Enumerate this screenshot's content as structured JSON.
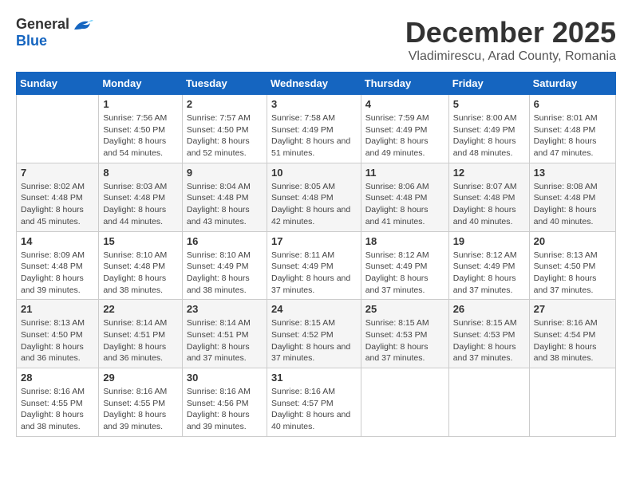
{
  "logo": {
    "general": "General",
    "blue": "Blue"
  },
  "title": "December 2025",
  "location": "Vladimirescu, Arad County, Romania",
  "weekdays": [
    "Sunday",
    "Monday",
    "Tuesday",
    "Wednesday",
    "Thursday",
    "Friday",
    "Saturday"
  ],
  "weeks": [
    [
      {
        "day": "",
        "sunrise": "",
        "sunset": "",
        "daylight": ""
      },
      {
        "day": "1",
        "sunrise": "Sunrise: 7:56 AM",
        "sunset": "Sunset: 4:50 PM",
        "daylight": "Daylight: 8 hours and 54 minutes."
      },
      {
        "day": "2",
        "sunrise": "Sunrise: 7:57 AM",
        "sunset": "Sunset: 4:50 PM",
        "daylight": "Daylight: 8 hours and 52 minutes."
      },
      {
        "day": "3",
        "sunrise": "Sunrise: 7:58 AM",
        "sunset": "Sunset: 4:49 PM",
        "daylight": "Daylight: 8 hours and 51 minutes."
      },
      {
        "day": "4",
        "sunrise": "Sunrise: 7:59 AM",
        "sunset": "Sunset: 4:49 PM",
        "daylight": "Daylight: 8 hours and 49 minutes."
      },
      {
        "day": "5",
        "sunrise": "Sunrise: 8:00 AM",
        "sunset": "Sunset: 4:49 PM",
        "daylight": "Daylight: 8 hours and 48 minutes."
      },
      {
        "day": "6",
        "sunrise": "Sunrise: 8:01 AM",
        "sunset": "Sunset: 4:48 PM",
        "daylight": "Daylight: 8 hours and 47 minutes."
      }
    ],
    [
      {
        "day": "7",
        "sunrise": "Sunrise: 8:02 AM",
        "sunset": "Sunset: 4:48 PM",
        "daylight": "Daylight: 8 hours and 45 minutes."
      },
      {
        "day": "8",
        "sunrise": "Sunrise: 8:03 AM",
        "sunset": "Sunset: 4:48 PM",
        "daylight": "Daylight: 8 hours and 44 minutes."
      },
      {
        "day": "9",
        "sunrise": "Sunrise: 8:04 AM",
        "sunset": "Sunset: 4:48 PM",
        "daylight": "Daylight: 8 hours and 43 minutes."
      },
      {
        "day": "10",
        "sunrise": "Sunrise: 8:05 AM",
        "sunset": "Sunset: 4:48 PM",
        "daylight": "Daylight: 8 hours and 42 minutes."
      },
      {
        "day": "11",
        "sunrise": "Sunrise: 8:06 AM",
        "sunset": "Sunset: 4:48 PM",
        "daylight": "Daylight: 8 hours and 41 minutes."
      },
      {
        "day": "12",
        "sunrise": "Sunrise: 8:07 AM",
        "sunset": "Sunset: 4:48 PM",
        "daylight": "Daylight: 8 hours and 40 minutes."
      },
      {
        "day": "13",
        "sunrise": "Sunrise: 8:08 AM",
        "sunset": "Sunset: 4:48 PM",
        "daylight": "Daylight: 8 hours and 40 minutes."
      }
    ],
    [
      {
        "day": "14",
        "sunrise": "Sunrise: 8:09 AM",
        "sunset": "Sunset: 4:48 PM",
        "daylight": "Daylight: 8 hours and 39 minutes."
      },
      {
        "day": "15",
        "sunrise": "Sunrise: 8:10 AM",
        "sunset": "Sunset: 4:48 PM",
        "daylight": "Daylight: 8 hours and 38 minutes."
      },
      {
        "day": "16",
        "sunrise": "Sunrise: 8:10 AM",
        "sunset": "Sunset: 4:49 PM",
        "daylight": "Daylight: 8 hours and 38 minutes."
      },
      {
        "day": "17",
        "sunrise": "Sunrise: 8:11 AM",
        "sunset": "Sunset: 4:49 PM",
        "daylight": "Daylight: 8 hours and 37 minutes."
      },
      {
        "day": "18",
        "sunrise": "Sunrise: 8:12 AM",
        "sunset": "Sunset: 4:49 PM",
        "daylight": "Daylight: 8 hours and 37 minutes."
      },
      {
        "day": "19",
        "sunrise": "Sunrise: 8:12 AM",
        "sunset": "Sunset: 4:49 PM",
        "daylight": "Daylight: 8 hours and 37 minutes."
      },
      {
        "day": "20",
        "sunrise": "Sunrise: 8:13 AM",
        "sunset": "Sunset: 4:50 PM",
        "daylight": "Daylight: 8 hours and 37 minutes."
      }
    ],
    [
      {
        "day": "21",
        "sunrise": "Sunrise: 8:13 AM",
        "sunset": "Sunset: 4:50 PM",
        "daylight": "Daylight: 8 hours and 36 minutes."
      },
      {
        "day": "22",
        "sunrise": "Sunrise: 8:14 AM",
        "sunset": "Sunset: 4:51 PM",
        "daylight": "Daylight: 8 hours and 36 minutes."
      },
      {
        "day": "23",
        "sunrise": "Sunrise: 8:14 AM",
        "sunset": "Sunset: 4:51 PM",
        "daylight": "Daylight: 8 hours and 37 minutes."
      },
      {
        "day": "24",
        "sunrise": "Sunrise: 8:15 AM",
        "sunset": "Sunset: 4:52 PM",
        "daylight": "Daylight: 8 hours and 37 minutes."
      },
      {
        "day": "25",
        "sunrise": "Sunrise: 8:15 AM",
        "sunset": "Sunset: 4:53 PM",
        "daylight": "Daylight: 8 hours and 37 minutes."
      },
      {
        "day": "26",
        "sunrise": "Sunrise: 8:15 AM",
        "sunset": "Sunset: 4:53 PM",
        "daylight": "Daylight: 8 hours and 37 minutes."
      },
      {
        "day": "27",
        "sunrise": "Sunrise: 8:16 AM",
        "sunset": "Sunset: 4:54 PM",
        "daylight": "Daylight: 8 hours and 38 minutes."
      }
    ],
    [
      {
        "day": "28",
        "sunrise": "Sunrise: 8:16 AM",
        "sunset": "Sunset: 4:55 PM",
        "daylight": "Daylight: 8 hours and 38 minutes."
      },
      {
        "day": "29",
        "sunrise": "Sunrise: 8:16 AM",
        "sunset": "Sunset: 4:55 PM",
        "daylight": "Daylight: 8 hours and 39 minutes."
      },
      {
        "day": "30",
        "sunrise": "Sunrise: 8:16 AM",
        "sunset": "Sunset: 4:56 PM",
        "daylight": "Daylight: 8 hours and 39 minutes."
      },
      {
        "day": "31",
        "sunrise": "Sunrise: 8:16 AM",
        "sunset": "Sunset: 4:57 PM",
        "daylight": "Daylight: 8 hours and 40 minutes."
      },
      {
        "day": "",
        "sunrise": "",
        "sunset": "",
        "daylight": ""
      },
      {
        "day": "",
        "sunrise": "",
        "sunset": "",
        "daylight": ""
      },
      {
        "day": "",
        "sunrise": "",
        "sunset": "",
        "daylight": ""
      }
    ]
  ]
}
